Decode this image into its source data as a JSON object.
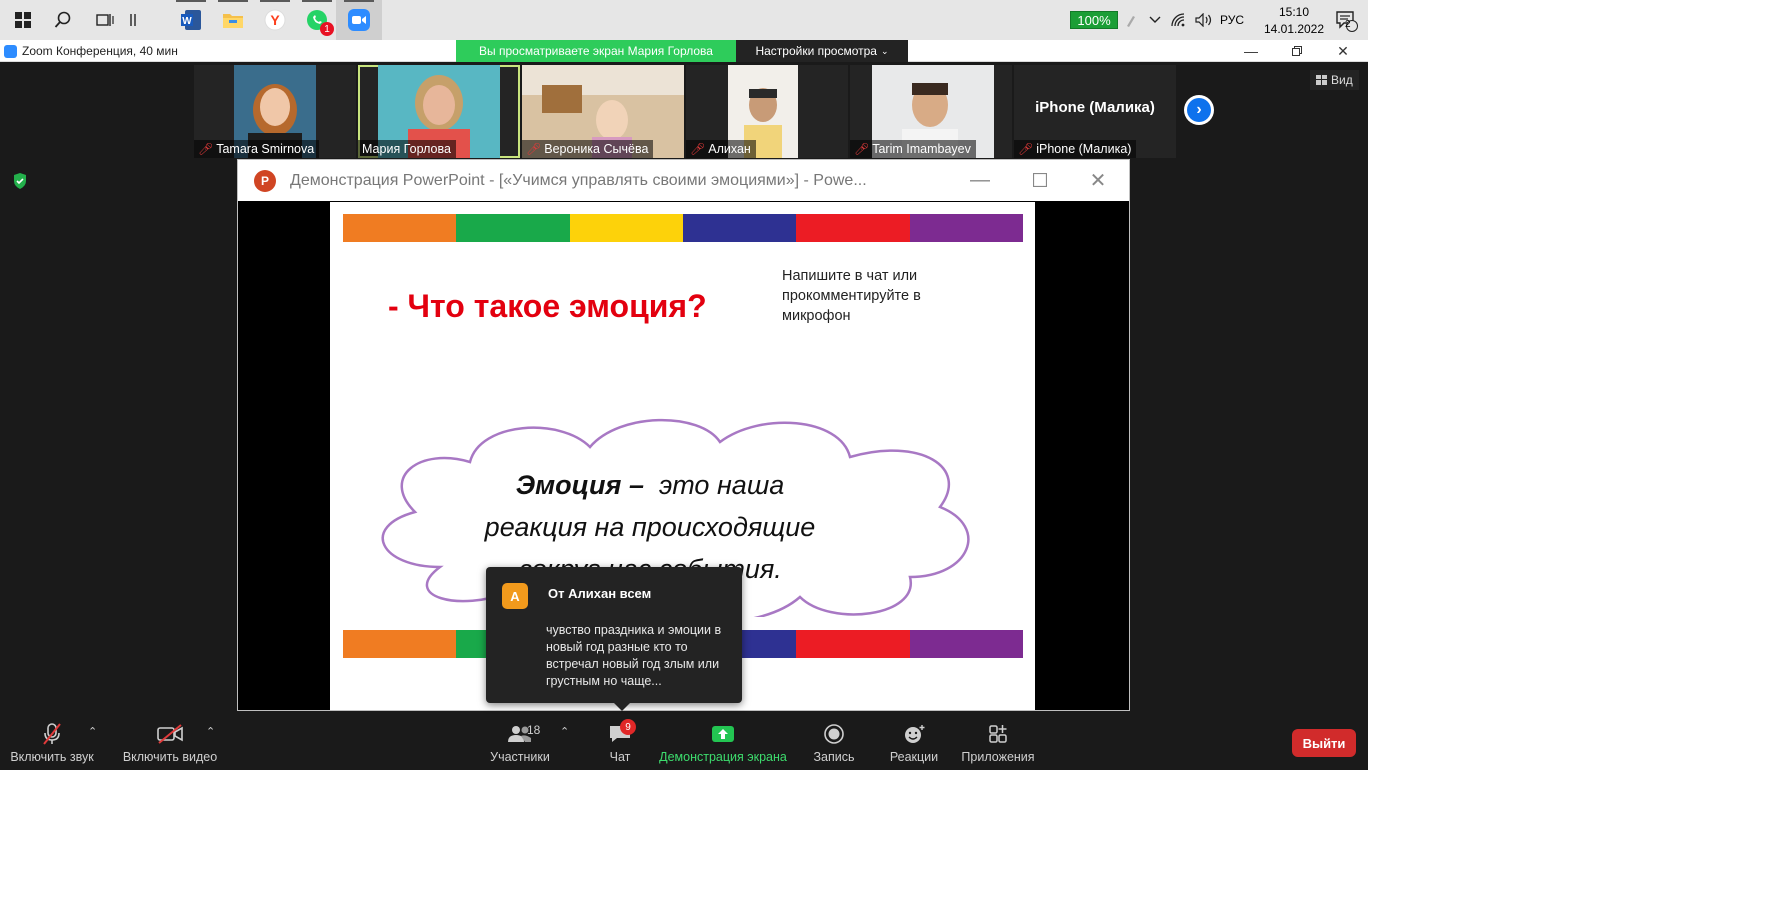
{
  "taskbar": {
    "icons": [
      "windows-start-icon",
      "search-icon",
      "task-view-icon",
      "separator-icon",
      "word-icon",
      "file-explorer-icon",
      "yandex-browser-icon",
      "whatsapp-icon",
      "zoom-icon"
    ],
    "whatsapp_badge": "1",
    "battery": "100%",
    "language": "РУС",
    "time": "15:10",
    "date": "14.01.2022",
    "notification_count": "2"
  },
  "zoom_window": {
    "title": "Zoom Конференция, 40 мин",
    "viewing_banner": "Вы просматриваете экран Мария Горлова",
    "view_settings": "Настройки просмотра"
  },
  "participants_strip": {
    "tiles": [
      {
        "name": "Tamara Smirnova",
        "muted": true
      },
      {
        "name": "Мария Горлова",
        "muted": false
      },
      {
        "name": "Вероника Сычёва",
        "muted": true
      },
      {
        "name": "Алихан",
        "muted": true
      },
      {
        "name": "Tarim Imambayev",
        "muted": true
      },
      {
        "name": "iPhone (Малика)",
        "muted": true
      }
    ],
    "iphone_display_name": "iPhone (Малика)",
    "view_button": "Вид"
  },
  "powerpoint": {
    "title": "Демонстрация PowerPoint - [«Учимся управлять своими эмоциями»] - Powe...",
    "logo_letter": "P",
    "slide": {
      "question": "- Что такое эмоция?",
      "instruction": "Напишите в чат или прокомментируйте в микрофон",
      "definition_term": "Эмоция",
      "definition_dash": " –  ",
      "definition_rest1": "это наша",
      "definition_line2": "реакция на происходящие",
      "definition_line3": "вокруг нас события.",
      "stripe_colors": [
        "#f07c22",
        "#19a94a",
        "#fdd20a",
        "#2e3192",
        "#ec1c24",
        "#7d2b91"
      ]
    }
  },
  "chat_popup": {
    "avatar_letter": "А",
    "from": "От Алихан всем",
    "message": "чувство праздника и эмоции в новый год разные кто то встречал новый год злым или грустным но чаще..."
  },
  "toolbar": {
    "unmute": "Включить звук",
    "start_video": "Включить видео",
    "participants": "Участники",
    "participants_count": "18",
    "chat": "Чат",
    "chat_badge": "9",
    "share_screen": "Демонстрация экрана",
    "record": "Запись",
    "reactions": "Реакции",
    "apps": "Приложения",
    "leave": "Выйти"
  }
}
